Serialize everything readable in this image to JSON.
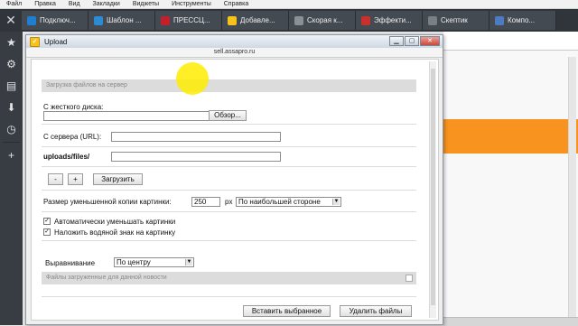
{
  "menubar": [
    "Файл",
    "Правка",
    "Вид",
    "Закладки",
    "Виджеты",
    "Инструменты",
    "Справка"
  ],
  "tabs": [
    {
      "label": "Подключ...",
      "color": "#1f7ecf"
    },
    {
      "label": "Шаблон ...",
      "color": "#2d8bd3"
    },
    {
      "label": "ПРЕССЦ...",
      "color": "#c4202b"
    },
    {
      "label": "Добавле...",
      "color": "#f6c21b"
    },
    {
      "label": "Скорая к...",
      "color": "#8b8f96"
    },
    {
      "label": "Эффекти...",
      "color": "#c9302c"
    },
    {
      "label": "Скептик",
      "color": "#7a7f86"
    },
    {
      "label": "Компо...",
      "color": "#4b7bc0"
    }
  ],
  "window": {
    "title": "Upload",
    "url": "sell.assapro.ru"
  },
  "form": {
    "section_upload": "Загрузка файлов на сервер",
    "from_disk_label": "С жесткого диска:",
    "browse_button": "Обзор...",
    "from_url_label": "С сервера (URL):",
    "path_label": "uploads/files/",
    "minus_button": "-",
    "plus_button": "+",
    "upload_button": "Загрузить",
    "thumb_size_label": "Размер уменьшенной копии картинки:",
    "thumb_size_value": "250",
    "px_label": "px",
    "side_select": "По наибольшей стороне",
    "auto_shrink_label": "Автоматически уменьшать картинки",
    "auto_shrink_checked": true,
    "watermark_label": "Наложить водяной знак на картинку",
    "watermark_checked": true,
    "align_label": "Выравнивание",
    "align_select": "По центру",
    "section_news_files": "Файлы загруженные для данной новости",
    "insert_selected_button": "Вставить выбранное",
    "delete_files_button": "Удалить файлы"
  }
}
